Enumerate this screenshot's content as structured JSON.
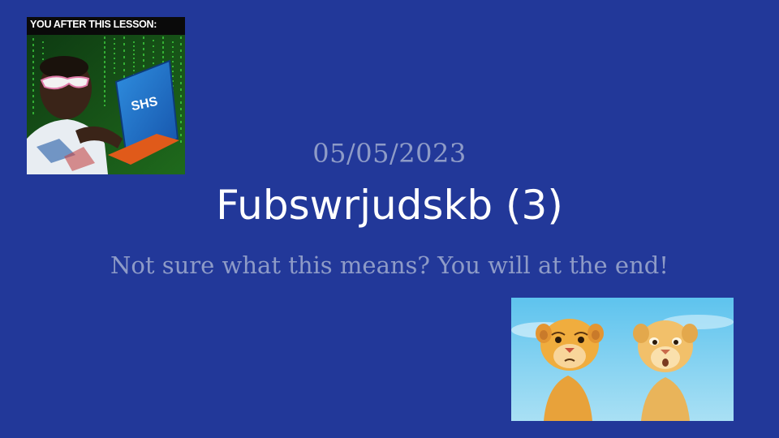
{
  "slide": {
    "background": "#223899",
    "date": "05/05/2023",
    "title": "Fubswrjudskb (3)",
    "subtitle": "Not sure what this means? You will at the end!"
  },
  "meme": {
    "caption": "YOU AFTER THIS LESSON:",
    "laptop_text": "SHS",
    "icon": "hacker-meme-image"
  },
  "cubs_image": {
    "icon": "lion-cubs-image"
  }
}
